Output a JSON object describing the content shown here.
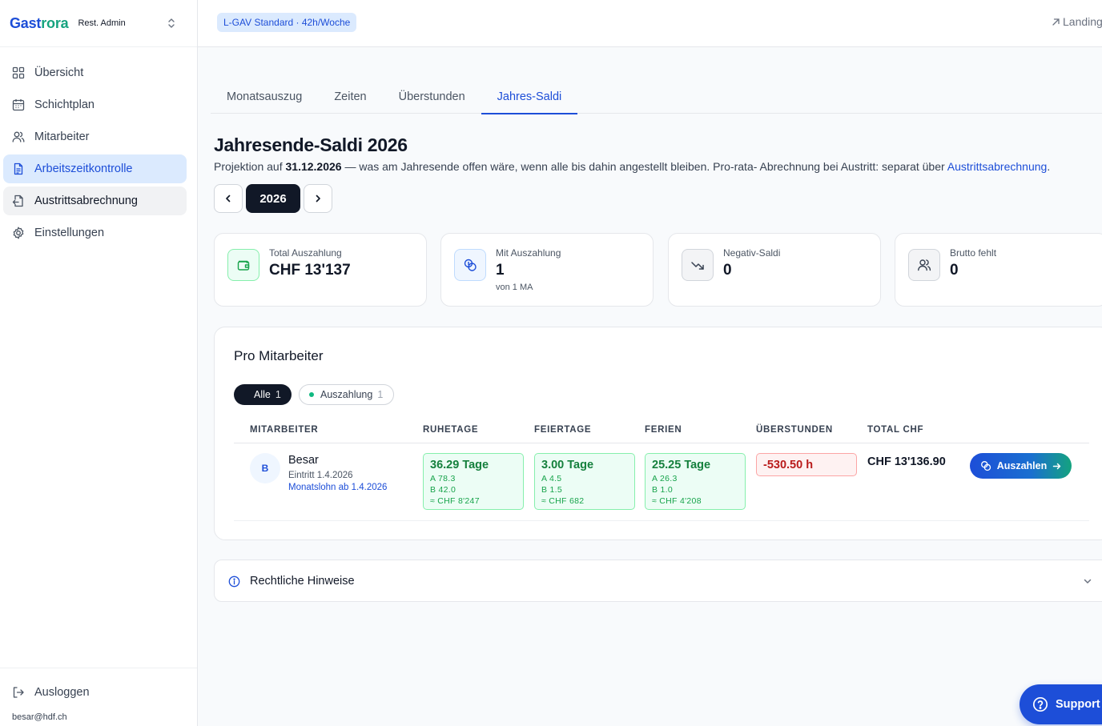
{
  "brand": {
    "part1": "Gast",
    "part2": "rora",
    "role": "Rest. Admin"
  },
  "sidebar": {
    "items": [
      {
        "label": "Übersicht",
        "icon": "grid-icon"
      },
      {
        "label": "Schichtplan",
        "icon": "calendar-icon"
      },
      {
        "label": "Mitarbeiter",
        "icon": "users-icon"
      },
      {
        "label": "Arbeitszeitkontrolle",
        "icon": "document-icon"
      },
      {
        "label": "Austrittsabrechnung",
        "icon": "file-exit-icon"
      },
      {
        "label": "Einstellungen",
        "icon": "gear-icon"
      }
    ],
    "logout": "Ausloggen",
    "email": "besar@hdf.ch"
  },
  "topbar": {
    "badge": "L-GAV Standard · 42h/Woche",
    "landing": "Landing"
  },
  "tabs": [
    "Monatsauszug",
    "Zeiten",
    "Überstunden",
    "Jahres-Saldi"
  ],
  "page": {
    "title": "Jahresende-Saldi 2026",
    "subtitle_pre": "Projektion auf ",
    "subtitle_date": "31.12.2026",
    "subtitle_mid": " — was am Jahresende offen wäre, wenn alle bis dahin angestellt bleiben. Pro-rata- Abrechnung bei Austritt: separat über ",
    "subtitle_link": "Austrittsabrechnung",
    "subtitle_end": ".",
    "year": "2026"
  },
  "stats": [
    {
      "label": "Total Auszahlung",
      "value": "CHF 13'137",
      "note": ""
    },
    {
      "label": "Mit Auszahlung",
      "value": "1",
      "note": "von 1 MA"
    },
    {
      "label": "Negativ-Saldi",
      "value": "0",
      "note": ""
    },
    {
      "label": "Brutto fehlt",
      "value": "0",
      "note": ""
    }
  ],
  "panel": {
    "title": "Pro Mitarbeiter",
    "filters": [
      {
        "label": "Alle",
        "count": "1"
      },
      {
        "label": "Auszahlung",
        "count": "1"
      }
    ],
    "columns": [
      "MITARBEITER",
      "RUHETAGE",
      "FEIERTAGE",
      "FERIEN",
      "ÜBERSTUNDEN",
      "TOTAL CHF"
    ],
    "rows": [
      {
        "initial": "B",
        "name": "Besar",
        "entry": "Eintritt 1.4.2026",
        "link": "Monatslohn ab 1.4.2026",
        "ruhetage": {
          "main": "36.29 Tage",
          "a": "A 78.3",
          "b": "B 42.0",
          "chf": "≈ CHF 8'247"
        },
        "feiertage": {
          "main": "3.00 Tage",
          "a": "A 4.5",
          "b": "B 1.5",
          "chf": "≈ CHF 682"
        },
        "ferien": {
          "main": "25.25 Tage",
          "a": "A 26.3",
          "b": "B 1.0",
          "chf": "≈ CHF 4'208"
        },
        "ueberstunden": "-530.50 h",
        "total": "CHF 13'136.90",
        "action": "Auszahlen"
      }
    ]
  },
  "legal": {
    "title": "Rechtliche Hinweise"
  },
  "support": {
    "label": "Support"
  },
  "colors": {
    "primary": "#1d4ed8",
    "accent": "#16a37f",
    "dark": "#111827",
    "positive_bg": "#ecfdf5",
    "negative_bg": "#fef2f2"
  }
}
